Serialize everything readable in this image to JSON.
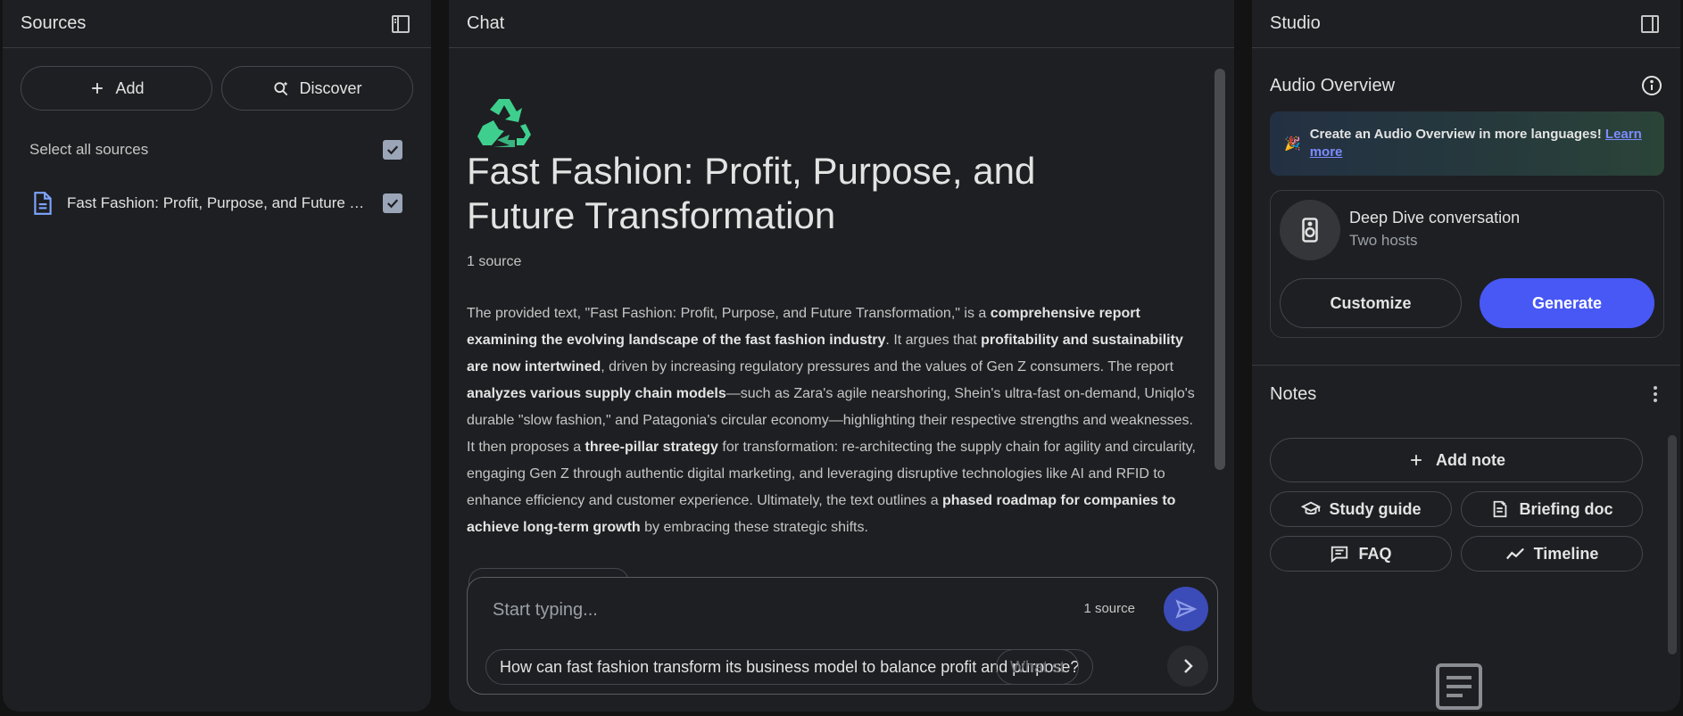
{
  "sources": {
    "title": "Sources",
    "add_label": "Add",
    "discover_label": "Discover",
    "select_all_label": "Select all sources",
    "items": [
      {
        "name": "Fast Fashion: Profit, Purpose, and Future Transformation",
        "checked": true
      }
    ]
  },
  "chat": {
    "title": "Chat",
    "notebook_title": "Fast Fashion: Profit, Purpose, and Future Transformation",
    "source_count": "1 source",
    "summary": {
      "p1": "The provided text, \"Fast Fashion: Profit, Purpose, and Future Transformation,\" is a ",
      "b1": "comprehensive report examining the evolving landscape of the fast fashion industry",
      "p2": ". It argues that ",
      "b2": "profitability and sustainability are now intertwined",
      "p3": ", driven by increasing regulatory pressures and the values of Gen Z consumers. The report ",
      "b3": "analyzes various supply chain models",
      "p4": "—such as Zara's agile nearshoring, Shein's ultra-fast on-demand, Uniqlo's durable \"slow fashion,\" and Patagonia's circular economy—highlighting their respective strengths and weaknesses. It then proposes a ",
      "b4": "three-pillar strategy",
      "p5": " for transformation: re-architecting the supply chain for agility and circularity, engaging Gen Z through authentic digital marketing, and leveraging disruptive technologies like AI and RFID to enhance efficiency and customer experience. Ultimately, the text outlines a ",
      "b5": "phased roadmap for companies to achieve long-term growth",
      "p6": " by embracing these strategic shifts."
    },
    "input": {
      "placeholder": "Start typing...",
      "value": "",
      "source_count": "1 source"
    },
    "suggestions": [
      "How can fast fashion transform its business model to balance profit and purpose?",
      "What st"
    ]
  },
  "studio": {
    "title": "Studio",
    "audio_overview": {
      "title": "Audio Overview",
      "banner_text": "Create an Audio Overview in more languages!",
      "banner_link": "Learn more",
      "card_title": "Deep Dive conversation",
      "card_subtitle": "Two hosts",
      "customize_label": "Customize",
      "generate_label": "Generate"
    },
    "notes": {
      "title": "Notes",
      "add_note_label": "Add note",
      "actions": [
        "Study guide",
        "Briefing doc",
        "FAQ",
        "Timeline"
      ]
    }
  },
  "colors": {
    "background": "#131314",
    "panel": "#1e1f22",
    "accent": "#4758f5",
    "send_button": "#3b4cb8",
    "link": "#7c8cff",
    "recycle_icon": "#3ecf8e"
  }
}
